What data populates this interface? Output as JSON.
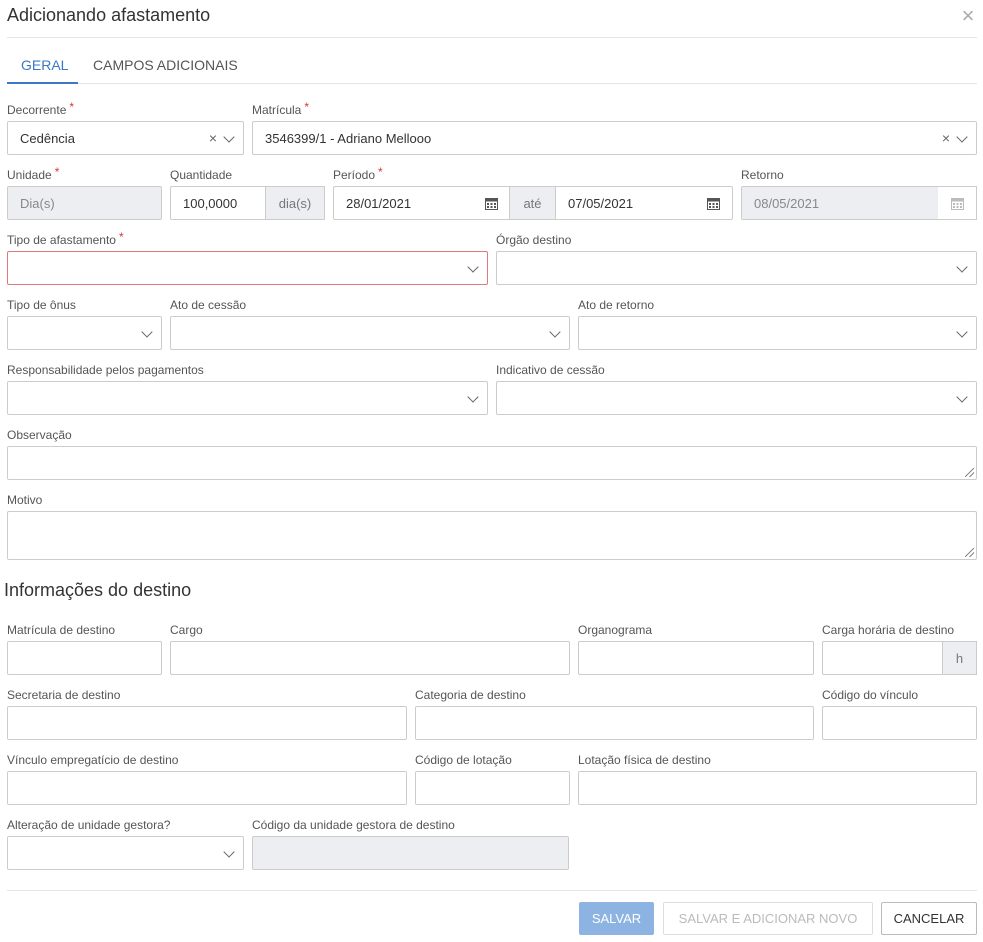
{
  "dialog": {
    "title": "Adicionando afastamento"
  },
  "tabs": [
    {
      "label": "GERAL"
    },
    {
      "label": "CAMPOS ADICIONAIS"
    }
  ],
  "fields": {
    "decorrente": {
      "label": "Decorrente",
      "value": "Cedência"
    },
    "matricula": {
      "label": "Matrícula",
      "value": "3546399/1 - Adriano Mellooo"
    },
    "unidade": {
      "label": "Unidade",
      "value": "Dia(s)"
    },
    "quantidade": {
      "label": "Quantidade",
      "value": "100,0000",
      "suffix": "dia(s)"
    },
    "periodo": {
      "label": "Período",
      "start": "28/01/2021",
      "sep": "até",
      "end": "07/05/2021"
    },
    "retorno": {
      "label": "Retorno",
      "value": "08/05/2021"
    },
    "tipo_afastamento": {
      "label": "Tipo de afastamento",
      "value": ""
    },
    "orgao_destino": {
      "label": "Órgão destino",
      "value": ""
    },
    "tipo_onus": {
      "label": "Tipo de ônus",
      "value": ""
    },
    "ato_cessao": {
      "label": "Ato de cessão",
      "value": ""
    },
    "ato_retorno": {
      "label": "Ato de retorno",
      "value": ""
    },
    "responsabilidade": {
      "label": "Responsabilidade pelos pagamentos",
      "value": ""
    },
    "indicativo_cessao": {
      "label": "Indicativo de cessão",
      "value": ""
    },
    "observacao": {
      "label": "Observação",
      "value": ""
    },
    "motivo": {
      "label": "Motivo",
      "value": ""
    }
  },
  "destino": {
    "section_title": "Informações do destino",
    "matricula_destino": {
      "label": "Matrícula de destino"
    },
    "cargo": {
      "label": "Cargo"
    },
    "organograma": {
      "label": "Organograma"
    },
    "carga_horaria": {
      "label": "Carga horária de destino",
      "suffix": "h"
    },
    "secretaria": {
      "label": "Secretaria de destino"
    },
    "categoria": {
      "label": "Categoria de destino"
    },
    "codigo_vinculo": {
      "label": "Código do vínculo"
    },
    "vinculo_empregaticio": {
      "label": "Vínculo empregatício de destino"
    },
    "codigo_lotacao": {
      "label": "Código de lotação"
    },
    "lotacao_fisica": {
      "label": "Lotação física de destino"
    },
    "alteracao_unidade": {
      "label": "Alteração de unidade gestora?"
    },
    "codigo_unidade_gestora": {
      "label": "Código da unidade gestora de destino"
    }
  },
  "buttons": {
    "save": "SALVAR",
    "save_new": "SALVAR E ADICIONAR NOVO",
    "cancel": "CANCELAR"
  },
  "colors": {
    "accent": "#3b78c6",
    "required": "#dd3333",
    "error_border": "#e07a7a"
  }
}
